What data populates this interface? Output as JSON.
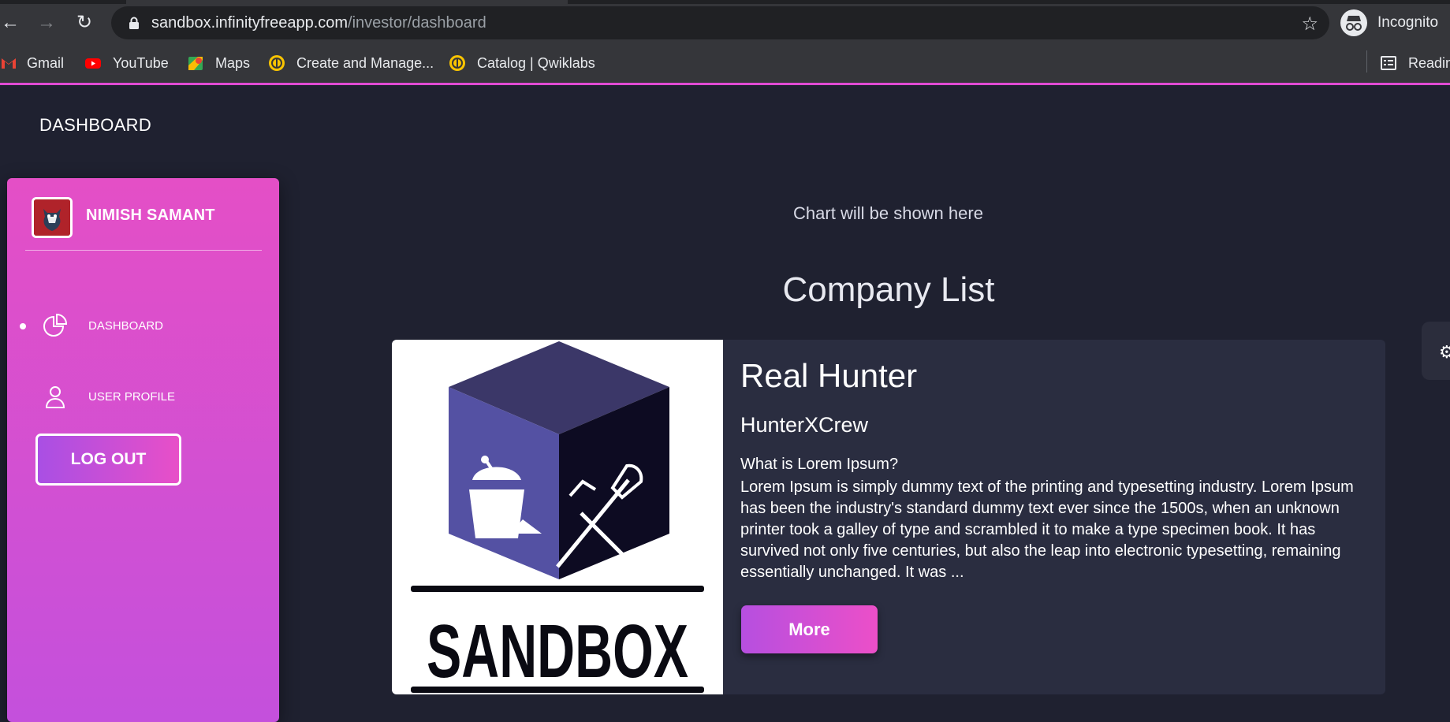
{
  "browser": {
    "url_host": "sandbox.infinityfreeapp.com",
    "url_path": "/investor/dashboard",
    "profile_label": "Incognito",
    "bookmarks": [
      {
        "label": "Gmail",
        "icon": "gmail-icon"
      },
      {
        "label": "YouTube",
        "icon": "youtube-icon"
      },
      {
        "label": "Maps",
        "icon": "maps-icon"
      },
      {
        "label": "Create and Manage...",
        "icon": "qwiklabs-icon"
      },
      {
        "label": "Catalog | Qwiklabs",
        "icon": "qwiklabs-icon"
      }
    ],
    "reading_list_label": "Readin"
  },
  "page": {
    "title": "DASHBOARD"
  },
  "sidebar": {
    "user_name": "NIMISH SAMANT",
    "items": [
      {
        "label": "DASHBOARD",
        "icon": "pie-chart-icon",
        "active": true
      },
      {
        "label": "USER PROFILE",
        "icon": "user-icon",
        "active": false
      }
    ],
    "logout_label": "LOG OUT"
  },
  "main": {
    "chart_placeholder": "Chart will be shown here",
    "company_list_heading": "Company List",
    "company": {
      "logo_text": "SANDBOX",
      "name": "Real Hunter",
      "team": "HunterXCrew",
      "desc_title": "What is Lorem Ipsum?",
      "desc_body": "Lorem Ipsum is simply dummy text of the printing and typesetting industry. Lorem Ipsum has been the industry's standard dummy text ever since the 1500s, when an unknown printer took a galley of type and scrambled it to make a type specimen book. It has survived not only five centuries, but also the leap into electronic typesetting, remaining essentially unchanged. It was ...",
      "more_label": "More"
    }
  },
  "colors": {
    "accent_pink": "#e44fc6",
    "accent_purple": "#b64fe0",
    "page_bg": "#1f2130",
    "card_bg": "#2a2d40"
  }
}
